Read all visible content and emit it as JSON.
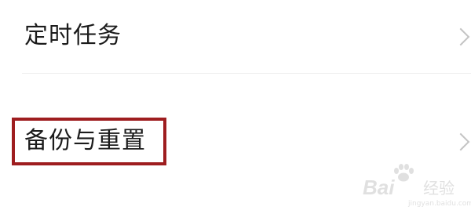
{
  "settings": {
    "items": [
      {
        "label": "定时任务"
      },
      {
        "label": "备份与重置"
      }
    ]
  },
  "watermark": {
    "brand": "Bai",
    "brand_suffix": "经验",
    "site": "jingyan.baidu.com"
  },
  "colors": {
    "highlight_box": "#9e1d1f",
    "chevron": "#c4c4c4",
    "divider": "#ededed",
    "text": "#1c1c1c"
  }
}
